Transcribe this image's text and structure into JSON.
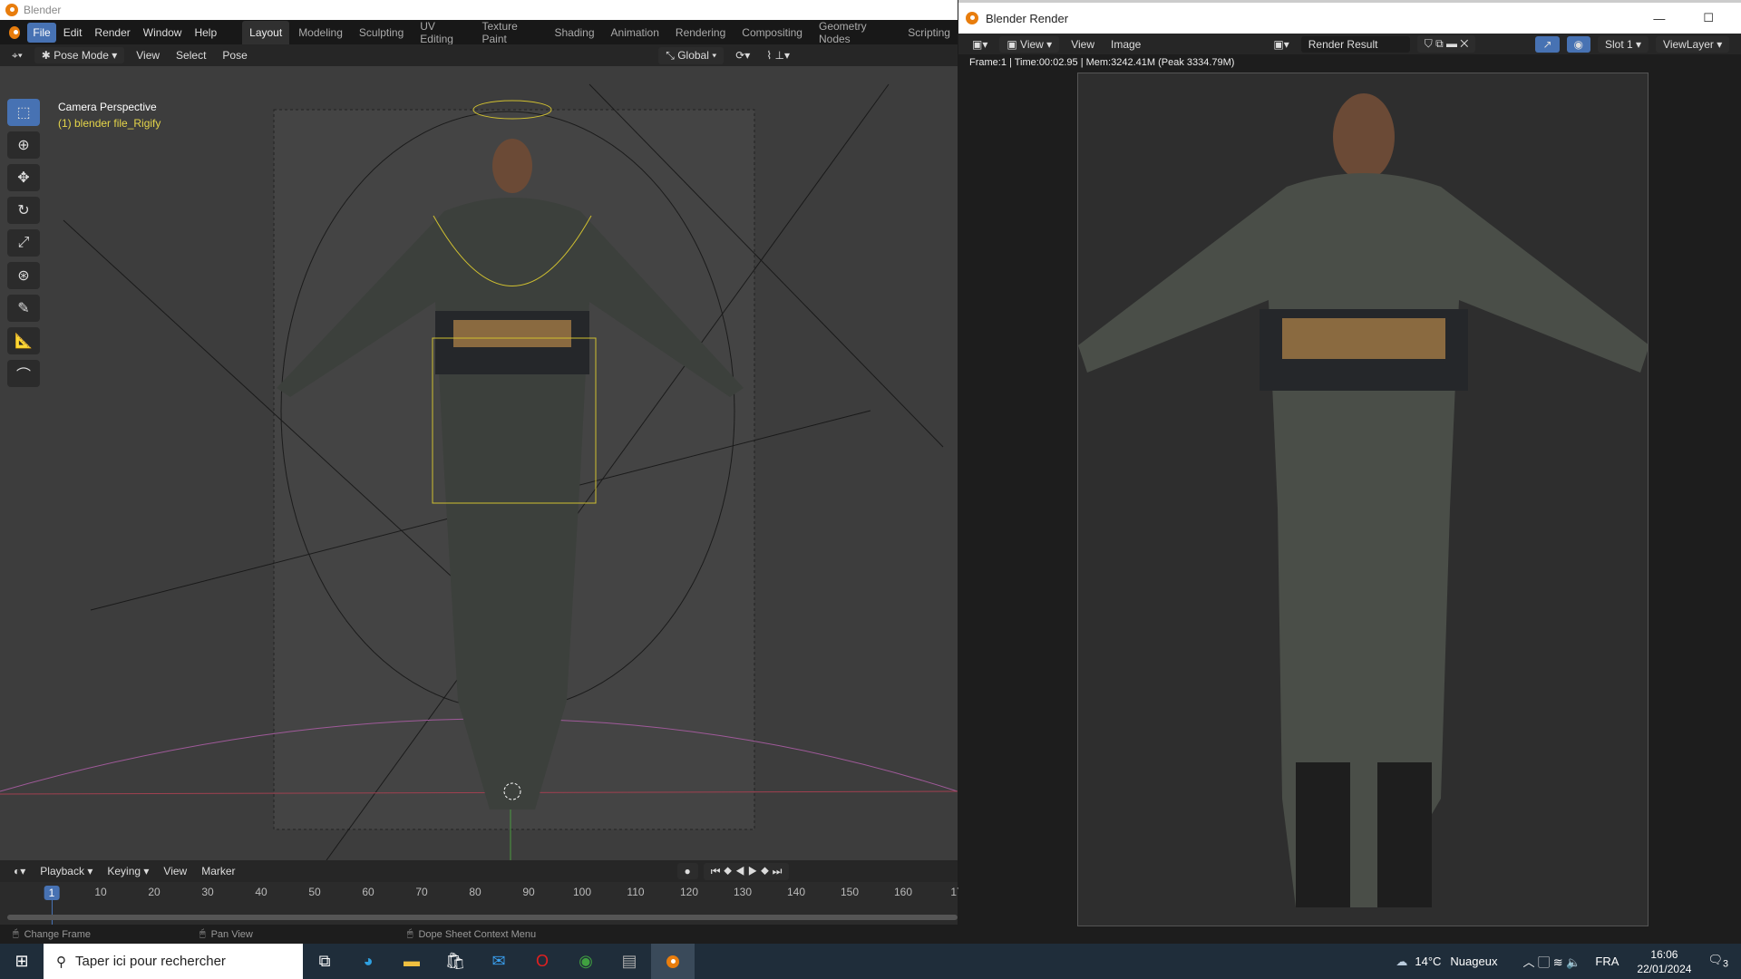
{
  "main_window": {
    "title": "Blender",
    "menu": [
      "File",
      "Edit",
      "Render",
      "Window",
      "Help"
    ],
    "workspaces": [
      "Layout",
      "Modeling",
      "Sculpting",
      "UV Editing",
      "Texture Paint",
      "Shading",
      "Animation",
      "Rendering",
      "Compositing",
      "Geometry Nodes",
      "Scripting"
    ],
    "viewport_header": {
      "mode": "Pose Mode",
      "menus": [
        "View",
        "Select",
        "Pose"
      ],
      "orientation": "Global"
    },
    "overlay": {
      "camera": "Camera Perspective",
      "object": "(1) blender file_Rigify"
    },
    "tools": [
      "select-box",
      "cursor",
      "move",
      "rotate",
      "scale",
      "transform",
      "annotate",
      "measure",
      "bone-roll"
    ],
    "timeline": {
      "menus": [
        "Playback",
        "Keying",
        "View",
        "Marker"
      ],
      "current_frame": "1",
      "ticks": [
        "10",
        "20",
        "30",
        "40",
        "50",
        "60",
        "70",
        "80",
        "90",
        "100",
        "110",
        "120",
        "130",
        "140",
        "150",
        "160",
        "17"
      ]
    },
    "status": [
      "Change Frame",
      "Pan View",
      "Dope Sheet Context Menu"
    ]
  },
  "render_window": {
    "title": "Blender Render",
    "menus": [
      "View",
      "View",
      "Image"
    ],
    "image_name": "Render Result",
    "slot": "Slot 1",
    "layer": "ViewLayer",
    "info": "Frame:1 | Time:00:02.95 | Mem:3242.41M (Peak 3334.79M)"
  },
  "taskbar": {
    "search_placeholder": "Taper ici pour rechercher",
    "weather_temp": "14°C",
    "weather_desc": "Nuageux",
    "lang": "FRA",
    "time": "16:06",
    "date": "22/01/2024",
    "notifications": "3"
  }
}
